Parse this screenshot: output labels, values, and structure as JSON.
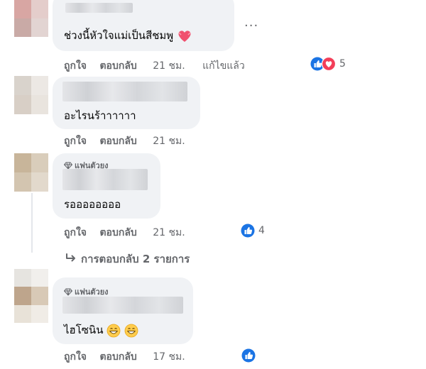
{
  "comments": [
    {
      "text": "ช่วงนี้หัวใจแม่เป็นสีชมพู",
      "like": "ถูกใจ",
      "reply": "ตอบกลับ",
      "time": "21 ชม.",
      "edited": "แก้ไขแล้ว",
      "reactions": "5",
      "menu": "···"
    },
    {
      "text": "อะไรนร้าาาาาา",
      "like": "ถูกใจ",
      "reply": "ตอบกลับ",
      "time": "21 ชม."
    },
    {
      "badge": "แฟนตัวยง",
      "text": "รออออออออ",
      "like": "ถูกใจ",
      "reply": "ตอบกลับ",
      "time": "21 ชม.",
      "reactions": "4"
    },
    {
      "badge": "แฟนตัวยง",
      "text": "ไฮโซนิน",
      "like": "ถูกใจ",
      "reply": "ตอบกลับ",
      "time": "17 ชม."
    }
  ],
  "view_replies": "การตอบกลับ 2 รายการ",
  "colors": {
    "like_blue": "#1b74e4",
    "love_red": "#f33e58",
    "muted": "#65676b",
    "bubble": "#f0f2f5"
  }
}
